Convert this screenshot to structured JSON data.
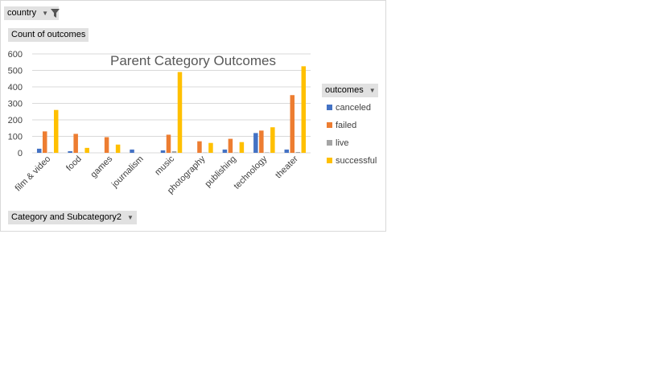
{
  "filters": {
    "country_label": "country",
    "values_label": "Count of outcomes",
    "axis_field_label": "Category and Subcategory2",
    "legend_field_label": "outcomes"
  },
  "chart_data": {
    "type": "bar",
    "title": "Parent Category Outcomes",
    "xlabel": "",
    "ylabel": "",
    "ylim": [
      0,
      600
    ],
    "yticks": [
      0,
      100,
      200,
      300,
      400,
      500,
      600
    ],
    "grid": true,
    "legend_position": "right",
    "categories": [
      "film & video",
      "food",
      "games",
      "journalism",
      "music",
      "photography",
      "publishing",
      "technology",
      "theater"
    ],
    "series": [
      {
        "name": "canceled",
        "color": "#4472c4",
        "values": [
          25,
          10,
          0,
          20,
          15,
          0,
          20,
          120,
          20
        ]
      },
      {
        "name": "failed",
        "color": "#ed7d31",
        "values": [
          130,
          115,
          95,
          0,
          110,
          70,
          85,
          135,
          350
        ]
      },
      {
        "name": "live",
        "color": "#a5a5a5",
        "values": [
          3,
          2,
          2,
          0,
          10,
          2,
          2,
          3,
          5
        ]
      },
      {
        "name": "successful",
        "color": "#ffc000",
        "values": [
          260,
          30,
          50,
          0,
          490,
          60,
          65,
          155,
          525
        ]
      }
    ]
  }
}
